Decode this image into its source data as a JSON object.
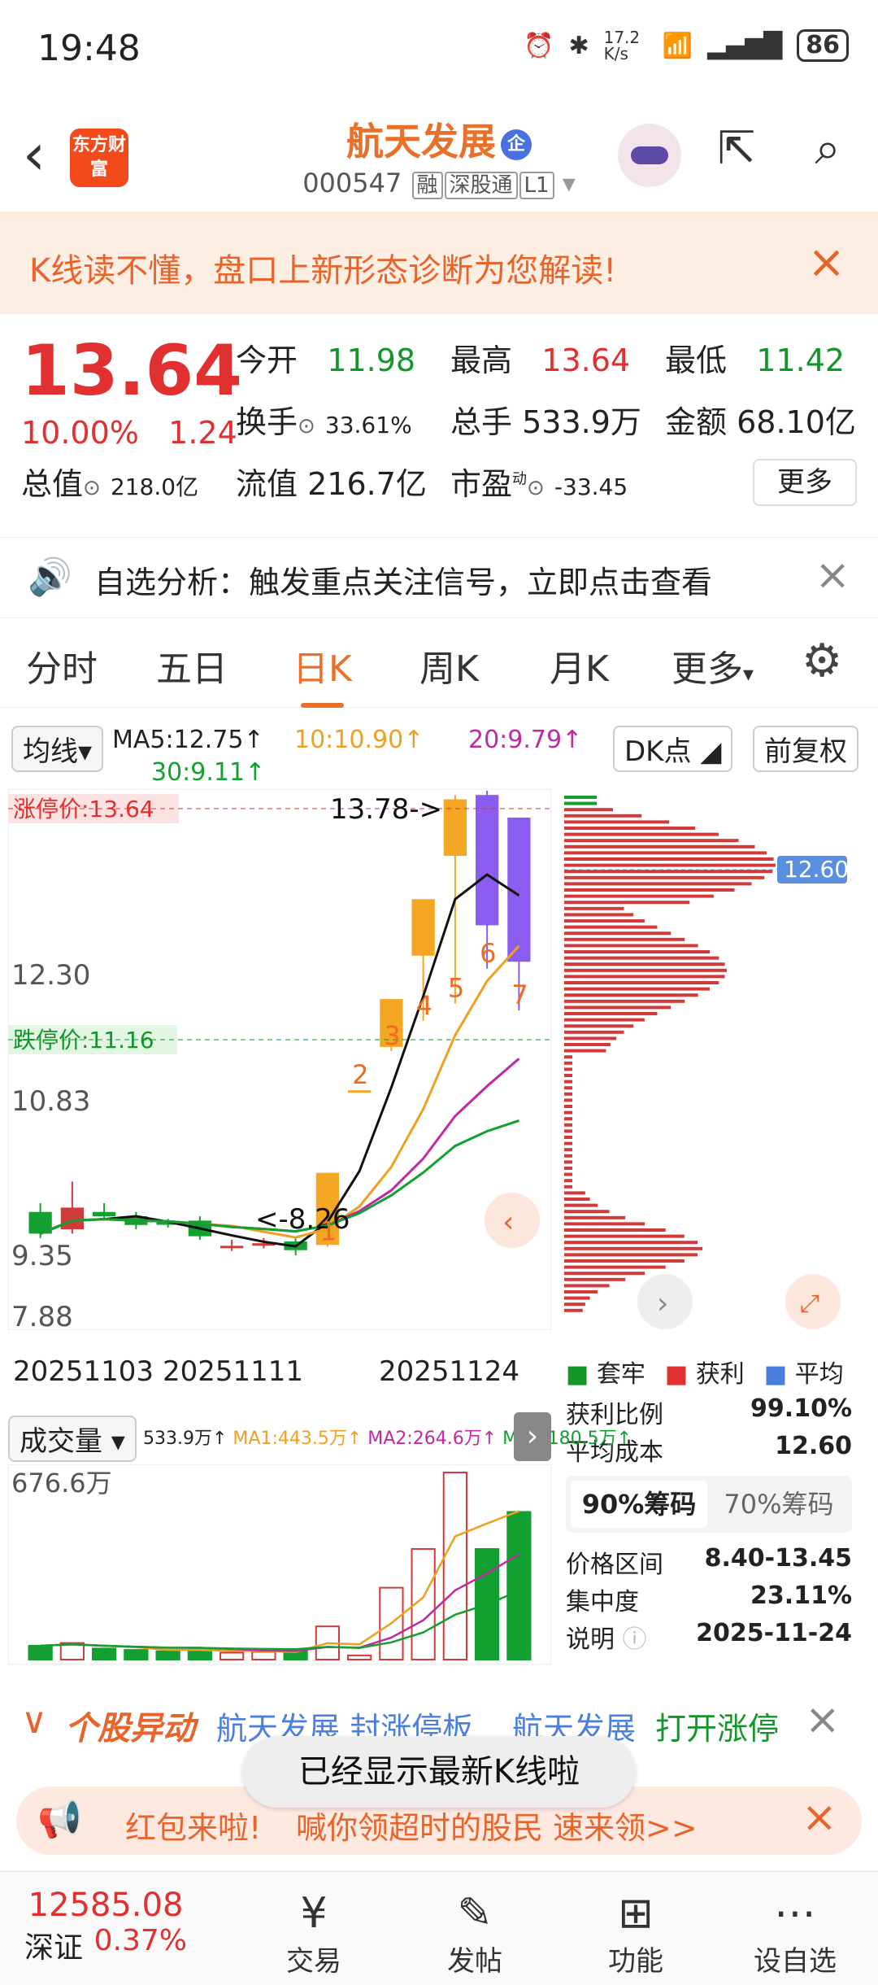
{
  "status": {
    "time": "19:48",
    "net_speed": "17.2 K/s",
    "battery": "86"
  },
  "header": {
    "logo": "东方财富",
    "stock_name": "航天发展",
    "badge": "企",
    "code": "000547",
    "tags": [
      "融",
      "深股通",
      "L1"
    ]
  },
  "banner": {
    "text": "K线读不懂，盘口上新形态诊断为您解读!"
  },
  "quote": {
    "price": "13.64",
    "change_pct": "10.00%",
    "change": "1.24",
    "open_label": "今开",
    "open": "11.98",
    "high_label": "最高",
    "high": "13.64",
    "low_label": "最低",
    "low": "11.42",
    "turnover_label": "换手",
    "turnover": "33.61%",
    "volume_label": "总手",
    "volume": "533.9万",
    "amount_label": "金额",
    "amount": "68.10亿",
    "mktcap_label": "总值",
    "mktcap": "218.0亿",
    "float_label": "流值",
    "float": "216.7亿",
    "pe_label": "市盈",
    "pe_sup": "动",
    "pe": "-33.45",
    "more": "更多"
  },
  "alert": {
    "text": "自选分析：触发重点关注信号，立即点击查看"
  },
  "tabs": [
    "分时",
    "五日",
    "日K",
    "周K",
    "月K",
    "更多"
  ],
  "chart": {
    "ma_select": "均线",
    "ma5": "MA5:12.75↑",
    "ma10": "10:10.90↑",
    "ma20": "20:9.79↑",
    "ma30": "30:9.11↑",
    "dk": "DK点",
    "adjust": "前复权",
    "limit_up": "涨停价:13.64",
    "limit_down": "跌停价:11.16",
    "high_mark": "13.78->",
    "low_mark": "<-8.26",
    "y_ticks": [
      "12.30",
      "10.83",
      "9.35",
      "7.88"
    ],
    "x_ticks": [
      "20251103",
      "20251111",
      "20251124"
    ],
    "chip_price": "12.60",
    "legend": [
      "套牢",
      "获利",
      "平均"
    ],
    "profit_ratio_label": "获利比例",
    "profit_ratio": "99.10%",
    "avg_cost_label": "平均成本",
    "avg_cost": "12.60",
    "chip_tabs": [
      "90%筹码",
      "70%筹码"
    ],
    "range_label": "价格区间",
    "range": "8.40-13.45",
    "conc_label": "集中度",
    "conc": "23.11%",
    "note_label": "说明",
    "note": "2025-11-24",
    "vol_select": "成交量",
    "vol_info": "533.9万↑",
    "vol_ma1": "MA1:443.5万↑",
    "vol_ma2": "MA2:264.6万↑",
    "vol_ma3": "MA3:180.5万↑",
    "vol_max": "676.6万",
    "markers": [
      "1",
      "2",
      "3",
      "4",
      "5",
      "6",
      "7"
    ]
  },
  "chart_data": {
    "type": "candlestick",
    "dates_visible": [
      "20251103",
      "20251111",
      "20251124"
    ],
    "ylim": [
      7.88,
      13.78
    ],
    "candles": [
      {
        "o": 9.1,
        "c": 8.85,
        "h": 9.2,
        "l": 8.8
      },
      {
        "o": 8.9,
        "c": 9.15,
        "h": 9.45,
        "l": 8.85
      },
      {
        "o": 9.1,
        "c": 9.05,
        "h": 9.2,
        "l": 9.0
      },
      {
        "o": 9.05,
        "c": 8.95,
        "h": 9.1,
        "l": 8.9
      },
      {
        "o": 8.98,
        "c": 8.96,
        "h": 9.02,
        "l": 8.92
      },
      {
        "o": 9.0,
        "c": 8.82,
        "h": 9.05,
        "l": 8.78
      },
      {
        "o": 8.7,
        "c": 8.71,
        "h": 8.78,
        "l": 8.65
      },
      {
        "o": 8.72,
        "c": 8.74,
        "h": 8.8,
        "l": 8.68
      },
      {
        "o": 8.76,
        "c": 8.66,
        "h": 8.8,
        "l": 8.6
      },
      {
        "o": 8.72,
        "c": 9.55,
        "h": 9.55,
        "l": 8.7
      },
      {
        "o": 10.5,
        "c": 10.5,
        "h": 10.5,
        "l": 10.5
      },
      {
        "o": 11.0,
        "c": 11.55,
        "h": 11.55,
        "l": 10.95
      },
      {
        "o": 12.05,
        "c": 12.7,
        "h": 12.7,
        "l": 11.3
      },
      {
        "o": 13.2,
        "c": 13.85,
        "h": 13.9,
        "l": 11.5
      },
      {
        "o": 13.9,
        "c": 12.4,
        "h": 13.95,
        "l": 11.9
      },
      {
        "o": 13.64,
        "c": 11.98,
        "h": 13.64,
        "l": 11.42
      }
    ],
    "volumes": [
      50,
      60,
      40,
      35,
      30,
      40,
      25,
      28,
      30,
      120,
      15,
      260,
      400,
      676.6,
      400,
      533.9
    ]
  },
  "abnormal": {
    "title": "个股异动",
    "text1": "航天发展 封涨停板",
    "text2": "航天发展",
    "text3": "打开涨停"
  },
  "toast": "已经显示最新K线啦",
  "redpack": {
    "text": "红包来啦!",
    "text2": "喊你领超时的股民",
    "text3": "速来领>>"
  },
  "nav": {
    "index_value": "12585.08",
    "index_name": "深证",
    "index_pct": "0.37%",
    "items": [
      "交易",
      "发帖",
      "功能",
      "设自选"
    ]
  }
}
